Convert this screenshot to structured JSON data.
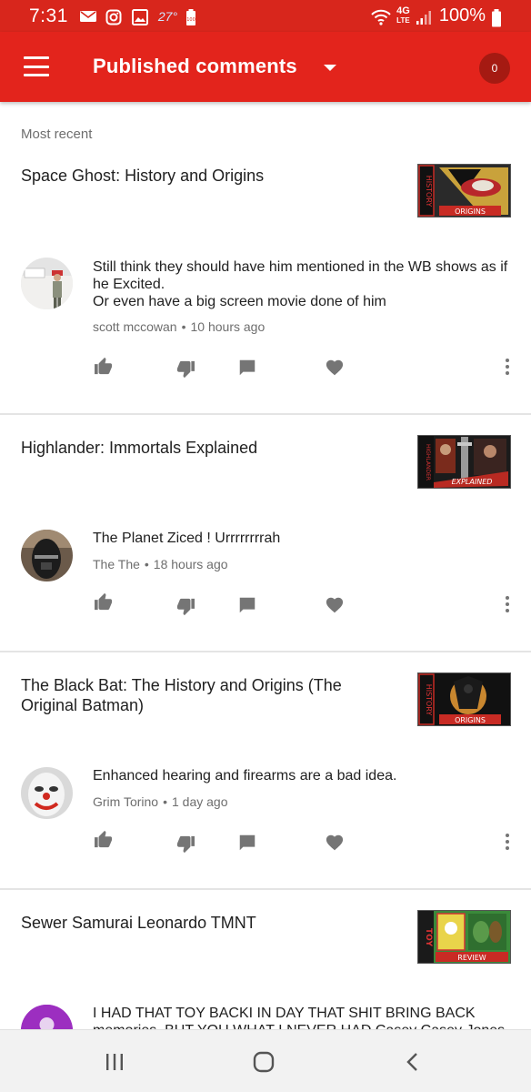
{
  "status_bar": {
    "time": "7:31",
    "temperature": "27°",
    "network": "4G",
    "network_sub": "LTE",
    "battery_text": "100%",
    "icons": [
      "mail-icon",
      "instagram-icon",
      "gallery-icon",
      "battery-saver-icon",
      "wifi-icon",
      "signal-icon",
      "battery-icon"
    ]
  },
  "app_bar": {
    "title": "Published comments",
    "count": "0",
    "color": "#e3241c"
  },
  "section_label": "Most recent",
  "comments": [
    {
      "video_title": "Space Ghost: History and Origins",
      "comment": "Still think they should have him mentioned in the WB shows as if he Excited.\nOr even have a big screen movie done of him",
      "author": "scott mccowan",
      "time": "10 hours ago",
      "thumb_top_label": "HISTORY",
      "thumb_bottom_label": "ORIGINS"
    },
    {
      "video_title": "Highlander: Immortals Explained",
      "comment": "The Planet Ziced ! Urrrrrrrrah",
      "author": "The The",
      "time": "18 hours ago",
      "thumb_top_label": "HIGHLANDER",
      "thumb_bottom_label": "EXPLAINED"
    },
    {
      "video_title": "The Black Bat: The History and Origins (The Original Batman)",
      "comment": "Enhanced hearing and firearms are a bad idea.",
      "author": "Grim Torino",
      "time": "1 day ago",
      "thumb_top_label": "HISTORY",
      "thumb_bottom_label": "ORIGINS"
    },
    {
      "video_title": "Sewer Samurai Leonardo TMNT",
      "comment": "I  HAD THAT TOY BACKI IN DAY THAT SHIT BRING BACK memories. BUT YOU WHAT I NEVER HAD Casey Casey Jones",
      "author": "",
      "time": "",
      "thumb_top_label": "TOY",
      "thumb_bottom_label": "REVIEW"
    }
  ],
  "nav_bar": {
    "icons": [
      "recent-apps-icon",
      "home-icon",
      "back-icon"
    ]
  }
}
